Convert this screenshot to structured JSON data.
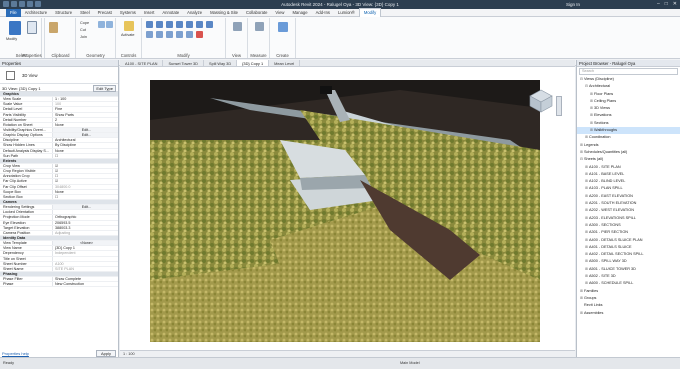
{
  "title": {
    "text": "Autodesk Revit 2024 - Ralugel Oya - 3D View: {3D} Copy 1",
    "sign_in": "Sign In",
    "window_controls": [
      "–",
      "□",
      "✕"
    ]
  },
  "ribbon_tabs": [
    "File",
    "Architecture",
    "Structure",
    "Steel",
    "Precast",
    "Systems",
    "Insert",
    "Annotate",
    "Analyze",
    "Massing & Site",
    "Collaborate",
    "View",
    "Manage",
    "Add-Ins",
    "Lumion®",
    "Modify"
  ],
  "ribbon": {
    "modify_label": "Modify",
    "groups": {
      "select": "Select",
      "properties": "Properties",
      "clipboard": "Clipboard",
      "geometry": "Geometry",
      "controls": "Controls",
      "modify": "Modify",
      "view": "View",
      "measure": "Measure",
      "create": "Create"
    },
    "clipboard_items": [
      "Cope",
      "Cut",
      "Join"
    ],
    "activate_label": "Activate"
  },
  "properties": {
    "header": "Properties",
    "type_name": "3D View",
    "filter_value": "3D View: {3D} Copy 1",
    "edit_type": "Edit Type",
    "rows": [
      {
        "cat": true,
        "k": "Graphics",
        "v": ""
      },
      {
        "k": "View Scale",
        "v": "1 : 100"
      },
      {
        "k": "Scale Value",
        "v": "100",
        "grey": true
      },
      {
        "k": "Detail Level",
        "v": "Fine"
      },
      {
        "k": "Parts Visibility",
        "v": "Show Parts"
      },
      {
        "k": "Detail Number",
        "v": "2"
      },
      {
        "k": "Rotation on Sheet",
        "v": "None"
      },
      {
        "k": "Visibility/Graphics Overri...",
        "v": "Edit...",
        "btn": true
      },
      {
        "k": "Graphic Display Options",
        "v": "Edit...",
        "btn": true
      },
      {
        "k": "Discipline",
        "v": "Architectural"
      },
      {
        "k": "Show Hidden Lines",
        "v": "By Discipline"
      },
      {
        "k": "Default Analysis Display S...",
        "v": "None"
      },
      {
        "k": "Sun Path",
        "v": "☐"
      },
      {
        "cat": true,
        "k": "Extents",
        "v": ""
      },
      {
        "k": "Crop View",
        "v": "☑"
      },
      {
        "k": "Crop Region Visible",
        "v": "☑"
      },
      {
        "k": "Annotation Crop",
        "v": "☐"
      },
      {
        "k": "Far Clip Active",
        "v": "☑"
      },
      {
        "k": "Far Clip Offset",
        "v": "304800.0",
        "grey": true
      },
      {
        "k": "Scope Box",
        "v": "None"
      },
      {
        "k": "Section Box",
        "v": "☐"
      },
      {
        "cat": true,
        "k": "Camera",
        "v": ""
      },
      {
        "k": "Rendering Settings",
        "v": "Edit...",
        "btn": true
      },
      {
        "k": "Locked Orientation",
        "v": "",
        "grey": true
      },
      {
        "k": "Projection Mode",
        "v": "Orthographic"
      },
      {
        "k": "Eye Elevation",
        "v": "206593.5"
      },
      {
        "k": "Target Elevation",
        "v": "388003.3"
      },
      {
        "k": "Camera Position",
        "v": "Adjusting",
        "grey": true
      },
      {
        "cat": true,
        "k": "Identity Data",
        "v": ""
      },
      {
        "k": "View Template",
        "v": "<None>",
        "btn": true
      },
      {
        "k": "View Name",
        "v": "{3D} Copy 1"
      },
      {
        "k": "Dependency",
        "v": "Independent",
        "grey": true
      },
      {
        "k": "Title on Sheet",
        "v": ""
      },
      {
        "k": "Sheet Number",
        "v": "A100",
        "grey": true
      },
      {
        "k": "Sheet Name",
        "v": "SITE PLAN",
        "grey": true
      },
      {
        "cat": true,
        "k": "Phasing",
        "v": ""
      },
      {
        "k": "Phase Filter",
        "v": "Show Complete"
      },
      {
        "k": "Phase",
        "v": "New Construction"
      }
    ],
    "help_link": "Properties help",
    "apply": "Apply"
  },
  "view_tabs": [
    {
      "label": "A100 - SITE PLAN",
      "active": false
    },
    {
      "label": "Sunset Tower 3D",
      "active": false
    },
    {
      "label": "Spill Way 3D",
      "active": false
    },
    {
      "label": "{3D} Copy 1",
      "active": true
    },
    {
      "label": "Mean Level",
      "active": false
    }
  ],
  "view_control": {
    "scale": "1 : 100"
  },
  "browser": {
    "header": "Project Browser - Ralugel Oya",
    "search_placeholder": "Search",
    "nodes": [
      {
        "indent": 0,
        "exp": "⊟",
        "label": "Views (Discipline)"
      },
      {
        "indent": 1,
        "exp": "⊟",
        "label": "Architectural"
      },
      {
        "indent": 2,
        "exp": "⊞",
        "label": "Floor Plans"
      },
      {
        "indent": 2,
        "exp": "⊞",
        "label": "Ceiling Plans"
      },
      {
        "indent": 2,
        "exp": "⊞",
        "label": "3D Views"
      },
      {
        "indent": 2,
        "exp": "⊞",
        "label": "Elevations"
      },
      {
        "indent": 2,
        "exp": "⊞",
        "label": "Sections"
      },
      {
        "indent": 2,
        "exp": "⊞",
        "label": "Walkthroughs",
        "sel": true
      },
      {
        "indent": 1,
        "exp": "⊞",
        "label": "Coordination"
      },
      {
        "indent": 0,
        "exp": "⊞",
        "label": "Legends"
      },
      {
        "indent": 0,
        "exp": "⊞",
        "label": "Schedules/Quantities (all)"
      },
      {
        "indent": 0,
        "exp": "⊟",
        "label": "Sheets (all)"
      },
      {
        "indent": 1,
        "exp": "⊞",
        "label": "A100 - SITE PLAN"
      },
      {
        "indent": 1,
        "exp": "⊞",
        "label": "A101 - BASE LEVEL"
      },
      {
        "indent": 1,
        "exp": "⊞",
        "label": "A102 - BLIND LEVEL"
      },
      {
        "indent": 1,
        "exp": "⊞",
        "label": "A103 - PLAN SPILL"
      },
      {
        "indent": 1,
        "exp": "⊞",
        "label": "A200 - EAST ELEVATION"
      },
      {
        "indent": 1,
        "exp": "⊞",
        "label": "A201 - SOUTH ELEVATION"
      },
      {
        "indent": 1,
        "exp": "⊞",
        "label": "A202 - WEST ELEVATION"
      },
      {
        "indent": 1,
        "exp": "⊞",
        "label": "A203 - ELEVATIONS SPILL"
      },
      {
        "indent": 1,
        "exp": "⊞",
        "label": "A300 - SECTIONS"
      },
      {
        "indent": 1,
        "exp": "⊞",
        "label": "A301 - PIER SECTION"
      },
      {
        "indent": 1,
        "exp": "⊞",
        "label": "A400 - DETAILS SLUICE PLAN"
      },
      {
        "indent": 1,
        "exp": "⊞",
        "label": "A401 - DETAILS SLUICE"
      },
      {
        "indent": 1,
        "exp": "⊞",
        "label": "A402 - DETAIL SECTION SPILL"
      },
      {
        "indent": 1,
        "exp": "⊞",
        "label": "A500 - SPILL WAY 3D"
      },
      {
        "indent": 1,
        "exp": "⊞",
        "label": "A501 - SLUICE TOWER 3D"
      },
      {
        "indent": 1,
        "exp": "⊞",
        "label": "A502 - SITE 3D"
      },
      {
        "indent": 1,
        "exp": "⊞",
        "label": "A600 - SCHEDULE SPILL"
      },
      {
        "indent": 0,
        "exp": "⊞",
        "label": "Families"
      },
      {
        "indent": 0,
        "exp": "⊞",
        "label": "Groups"
      },
      {
        "indent": 0,
        "exp": "",
        "label": "Revit Links"
      },
      {
        "indent": 0,
        "exp": "⊞",
        "label": "Assemblies"
      }
    ]
  },
  "status": {
    "left": "Ready",
    "main_model": "Main Model"
  },
  "colors": {
    "accent": "#0a60b0",
    "titlebar": "#2c3e50",
    "selected": "#cde4fb"
  }
}
